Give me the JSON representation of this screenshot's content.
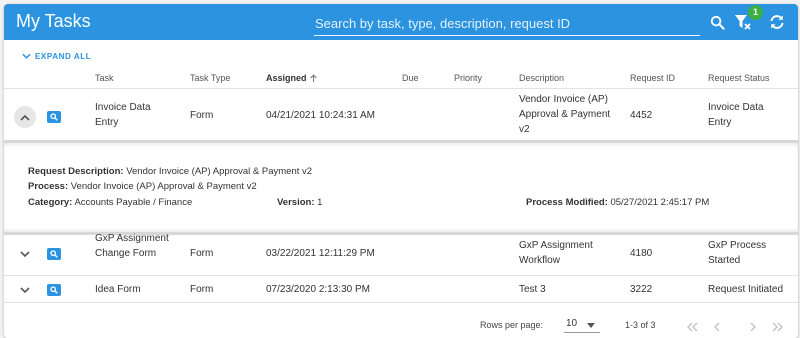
{
  "header": {
    "title": "My Tasks",
    "search_placeholder": "Search by task, type, description, request ID",
    "filter_badge": "1"
  },
  "toolbar": {
    "expand_all": "EXPAND ALL"
  },
  "columns": {
    "task": "Task",
    "type": "Task Type",
    "assigned": "Assigned",
    "due": "Due",
    "priority": "Priority",
    "description": "Description",
    "request_id": "Request ID",
    "status": "Request Status"
  },
  "rows": [
    {
      "task": "Invoice Data Entry",
      "type": "Form",
      "assigned": "04/21/2021 10:24:31 AM",
      "due": "",
      "priority": "",
      "description": "Vendor Invoice (AP) Approval & Payment v2",
      "request_id": "4452",
      "status": "Invoice Data Entry",
      "expanded": true
    },
    {
      "task": "GxP Assignment Change Form",
      "type": "Form",
      "assigned": "03/22/2021 12:11:29 PM",
      "due": "",
      "priority": "",
      "description": "GxP Assignment Workflow",
      "request_id": "4180",
      "status": "GxP Process Started",
      "expanded": false
    },
    {
      "task": "Idea Form",
      "type": "Form",
      "assigned": "07/23/2020 2:13:30 PM",
      "due": "",
      "priority": "",
      "description": "Test 3",
      "request_id": "3222",
      "status": "Request Initiated",
      "expanded": false
    }
  ],
  "detail": {
    "request_description_label": "Request Description:",
    "request_description": "Vendor Invoice (AP) Approval & Payment v2",
    "process_label": "Process:",
    "process": "Vendor Invoice (AP) Approval & Payment v2",
    "category_label": "Category:",
    "category": "Accounts Payable / Finance",
    "version_label": "Version:",
    "version": "1",
    "process_modified_label": "Process Modified:",
    "process_modified": "05/27/2021 2:45:17 PM"
  },
  "pagination": {
    "rows_per_page_label": "Rows per page:",
    "rows_per_page": "10",
    "range": "1-3 of 3"
  },
  "colors": {
    "accent": "#2b93e0",
    "badge": "#3eaf42"
  }
}
